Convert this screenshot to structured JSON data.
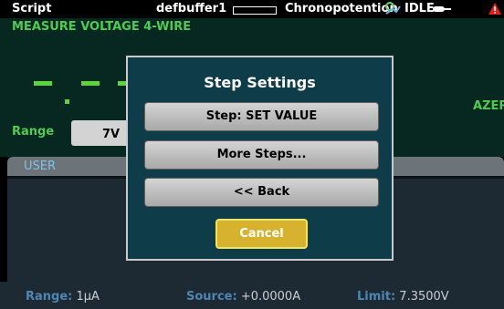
{
  "status_bar": {
    "script_label": "Script",
    "buffer_name": "defbuffer1",
    "mode_label": "Chronopotention",
    "state_label": "IDLE",
    "icons": [
      "buffer-gauge-icon",
      "script-running-icon",
      "trigger-icon",
      "warning-icon"
    ]
  },
  "measure": {
    "title": "MEASURE VOLTAGE 4-WIRE",
    "autozero_label": "AZERO",
    "range_label": "Range",
    "range_value": "7V"
  },
  "user_panel": {
    "tab_label": "USER"
  },
  "footer": {
    "range_key": "Range:",
    "range_value": "1μA",
    "source_key": "Source:",
    "source_value": "+0.0000A",
    "limit_key": "Limit:",
    "limit_value": "7.3500V"
  },
  "dialog": {
    "title": "Step Settings",
    "buttons": [
      {
        "label": "Step: SET VALUE"
      },
      {
        "label": "More Steps..."
      },
      {
        "label": "<< Back"
      }
    ],
    "cancel_label": "Cancel"
  },
  "colors": {
    "measure_green": "#4fcb54",
    "dialog_bg": "#0f3c49",
    "cancel_yellow": "#d6b22f",
    "warning_red": "#e0201b",
    "footer_key_blue": "#4d86b3"
  }
}
